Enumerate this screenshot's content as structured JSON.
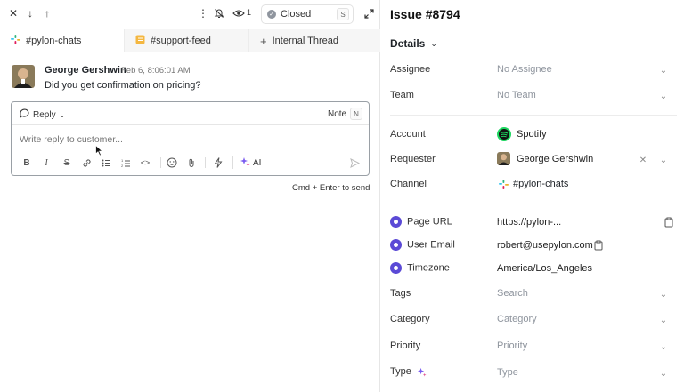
{
  "toolbar": {
    "close": "✕",
    "down": "↓",
    "up": "↑",
    "more": "⋮",
    "watchers_count": "1",
    "status_label": "Closed",
    "status_shortcut": "S"
  },
  "tabs": [
    {
      "label": "#pylon-chats",
      "icon": "slack-icon"
    },
    {
      "label": "#support-feed",
      "icon": "note-icon"
    },
    {
      "label": "Internal Thread",
      "icon": "plus-icon"
    }
  ],
  "message": {
    "author": "George Gershwin",
    "time": "Feb 6, 8:06:01 AM",
    "text": "Did you get confirmation on pricing?"
  },
  "composer": {
    "reply_label": "Reply",
    "note_label": "Note",
    "note_shortcut": "N",
    "placeholder": "Write reply to customer...",
    "ai_label": "AI",
    "send_hint": "Cmd + Enter to send"
  },
  "issue": {
    "title": "Issue #8794",
    "details_label": "Details",
    "fields": {
      "assignee_label": "Assignee",
      "assignee_value": "No Assignee",
      "team_label": "Team",
      "team_value": "No Team",
      "account_label": "Account",
      "account_value": "Spotify",
      "requester_label": "Requester",
      "requester_value": "George Gershwin",
      "channel_label": "Channel",
      "channel_value": "#pylon-chats",
      "page_url_label": "Page URL",
      "page_url_value": "https://pylon-...",
      "user_email_label": "User Email",
      "user_email_value": "robert@usepylon.com",
      "timezone_label": "Timezone",
      "timezone_value": "America/Los_Angeles",
      "tags_label": "Tags",
      "tags_placeholder": "Search",
      "category_label": "Category",
      "category_value": "Category",
      "priority_label": "Priority",
      "priority_value": "Priority",
      "type_label": "Type",
      "type_value": "Type"
    }
  },
  "colors": {
    "accent": "#5b4ad6",
    "spotify": "#1ed760",
    "border": "#e6e6e6"
  }
}
